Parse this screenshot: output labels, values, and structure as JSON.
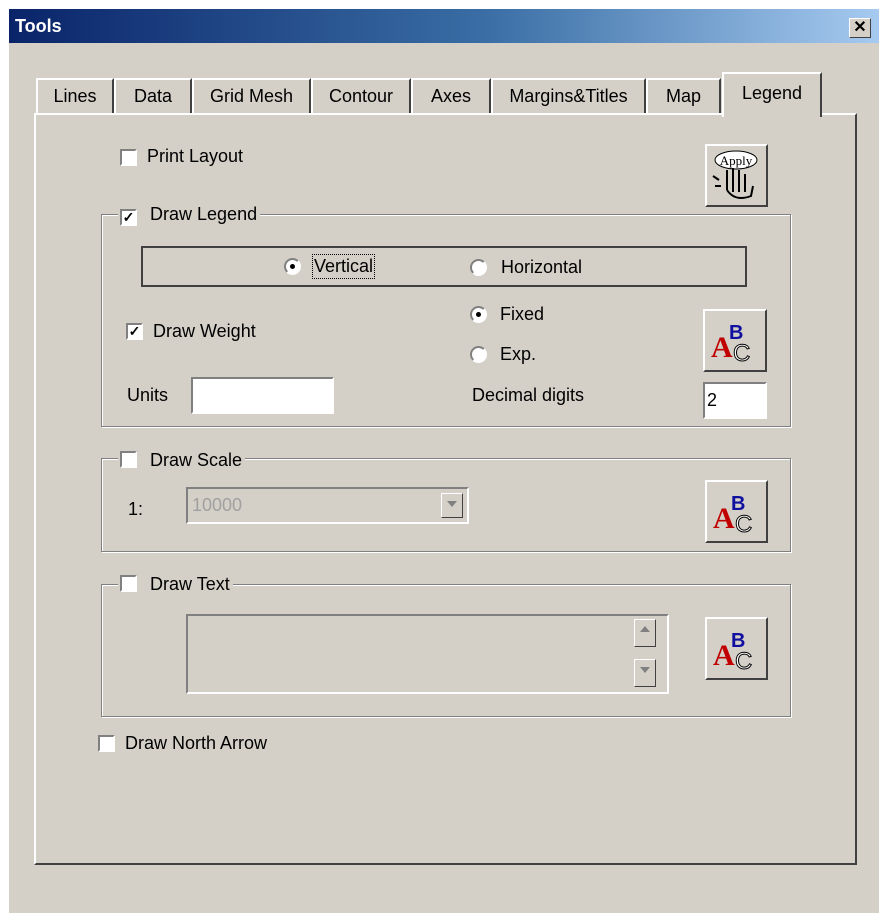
{
  "window": {
    "title": "Tools",
    "close_icon": "close-icon"
  },
  "tabs": [
    {
      "label": "Lines"
    },
    {
      "label": "Data"
    },
    {
      "label": "Grid Mesh"
    },
    {
      "label": "Contour"
    },
    {
      "label": "Axes"
    },
    {
      "label": "Margins&Titles"
    },
    {
      "label": "Map"
    },
    {
      "label": "Legend",
      "active": true
    }
  ],
  "legend_tab": {
    "print_layout": {
      "label": "Print Layout",
      "checked": false
    },
    "apply_button": {
      "label": "Apply",
      "icon": "apply-hand-icon"
    },
    "draw_legend": {
      "label": "Draw Legend",
      "checked": true,
      "orientation": {
        "vertical_label": "Vertical",
        "horizontal_label": "Horizontal",
        "selected": "Vertical"
      },
      "draw_weight": {
        "label": "Draw  Weight",
        "checked": true
      },
      "format": {
        "fixed_label": "Fixed",
        "exp_label": "Exp.",
        "selected": "Fixed"
      },
      "units_label": "Units",
      "units_value": "",
      "decimal_digits_label": "Decimal digits",
      "decimal_digits_value": "2",
      "font_button_icon": "font-abc-icon"
    },
    "draw_scale": {
      "label": "Draw Scale",
      "checked": false,
      "ratio_prefix": "1:",
      "scale_value": "10000",
      "font_button_icon": "font-abc-icon"
    },
    "draw_text": {
      "label": "Draw Text",
      "checked": false,
      "text_value": "",
      "font_button_icon": "font-abc-icon"
    },
    "draw_north_arrow": {
      "label": "Draw North Arrow",
      "checked": false
    }
  },
  "colors": {
    "face": "#d4d0c8",
    "title_start": "#0a246a",
    "title_end": "#a6caf0",
    "abc_red": "#c00000",
    "abc_blue": "#1010a0"
  }
}
